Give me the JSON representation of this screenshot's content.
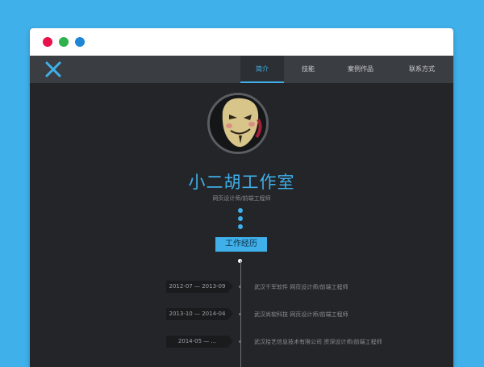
{
  "nav": {
    "items": [
      {
        "label": "简介",
        "active": true
      },
      {
        "label": "技能",
        "active": false
      },
      {
        "label": "案例作品",
        "active": false
      },
      {
        "label": "联系方式",
        "active": false
      }
    ]
  },
  "profile": {
    "name": "小二胡工作室",
    "role": "网页设计师/前端工程师"
  },
  "experience": {
    "heading": "工作经历",
    "entries": [
      {
        "period": "2012-07 — 2013-09",
        "detail": "武汉千军软件 网页设计师/前端工程师"
      },
      {
        "period": "2013-10 — 2014-04",
        "detail": "武汉尚软科技 网页设计师/前端工程师"
      },
      {
        "period": "2014-05 — ...",
        "detail": "武汉拾艺信息技术有限公司 资深设计师/前端工程师"
      }
    ]
  },
  "colors": {
    "accent": "#3fb0ea",
    "window_bg": "#232528",
    "navbar_bg": "#3a3d42",
    "traffic_red": "#e8114b",
    "traffic_green": "#2fb24b",
    "traffic_blue": "#1e86d6"
  }
}
